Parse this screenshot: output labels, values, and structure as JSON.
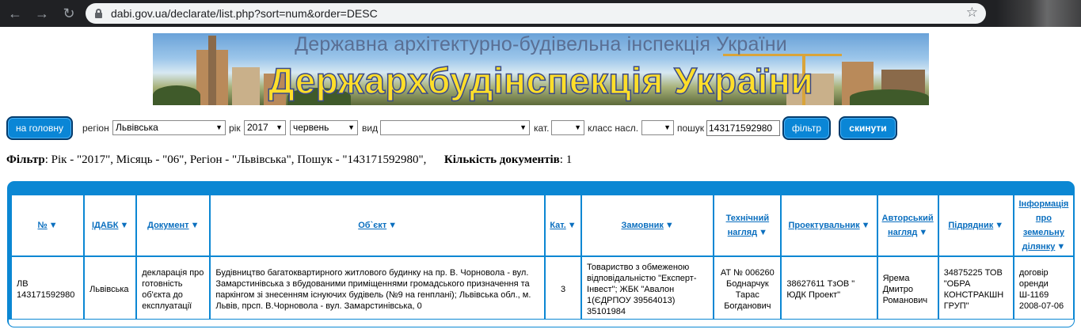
{
  "browser": {
    "url": "dabi.gov.ua/declarate/list.php?sort=num&order=DESC"
  },
  "banner": {
    "subtitle": "Державна архітектурно-будівельна інспекція України",
    "title": "Держархбудінспекція України"
  },
  "form": {
    "home_button": "на головну",
    "region_label": "регіон",
    "region_value": "Львівська",
    "year_label": "рік",
    "year_value": "2017",
    "month_value": "червень",
    "type_label": "вид",
    "type_value": "",
    "category_label": "кат.",
    "category_value": "",
    "class_label": "класс насл.",
    "class_value": "",
    "search_label": "пошук",
    "search_value": "143171592980",
    "filter_button": "фільтр",
    "reset_button": "скинути"
  },
  "summary": {
    "filter_label": "Фільтр",
    "filter_text": ": Рік - \"2017\", Місяць - \"06\", Регіон - \"Львівська\", Пошук - \"143171592980\",",
    "count_label": "Кількість документів",
    "count_value": ": 1"
  },
  "table": {
    "headers": [
      "№",
      "ІДАБК",
      "Документ",
      "Об`єкт",
      "Кат.",
      "Замовник",
      "Технічний нагляд",
      "Проектувальник",
      "Авторський нагляд",
      "Підрядник",
      "Інформація про земельну ділянку"
    ],
    "rows": [
      {
        "num": "ЛВ 143171592980",
        "idabk": "Львівська",
        "document": "декларація про готовність об'єкта до експлуатації",
        "object": "Будівництво багатоквартирного житлового будинку на пр. В. Чорновола - вул. Замарстинівська з вбудованими приміщеннями громадського призначення та паркінгом зі знесенням існуючих будівель (№9 на генплані); Львівська обл., м. Львів, прсп. В.Чорновола - вул. Замарстинівська, 0",
        "category": "3",
        "customer": "Товариство з обмеженою відповідальністю \"Експерт-Інвест\"; ЖБК \"Авалон 1(ЄДРПОУ 39564013) 35101984",
        "tech_supervision": "АТ № 006260 Боднарчук Тарас Богданович",
        "designer": "38627611 ТзОВ \" ЮДК Проект\"",
        "author_supervision": "Ярема Дмитро Романович",
        "contractor": "34875225 ТОВ \"ОБРА КОНСТРАКШН ГРУП\"",
        "land_info": "договір оренди Ш-1169 2008-07-06"
      }
    ]
  },
  "colors": {
    "accent": "#0b87d3",
    "button": "#0a86d6",
    "banner_title": "#ffde2a"
  }
}
